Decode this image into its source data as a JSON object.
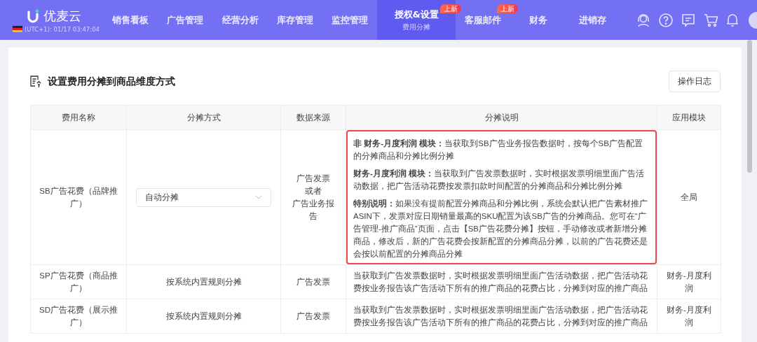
{
  "nav": {
    "logo": "优麦云",
    "timezone": "(UTC+1): 01/17 03:47:04",
    "items": [
      {
        "label": "销售看板",
        "selected": false
      },
      {
        "label": "广告管理",
        "selected": false
      },
      {
        "label": "经营分析",
        "selected": false
      },
      {
        "label": "库存管理",
        "selected": false
      },
      {
        "label": "监控管理",
        "selected": false
      },
      {
        "label": "授权&设置",
        "selected": true,
        "sub": "费用分摊",
        "badge": "上新"
      },
      {
        "label": "客服邮件",
        "selected": false,
        "badge": "上新"
      },
      {
        "label": "财务",
        "selected": false
      },
      {
        "label": "进销存",
        "selected": false
      }
    ]
  },
  "page": {
    "title": "设置费用分摊到商品维度方式",
    "log_button": "操作日志"
  },
  "table": {
    "columns": [
      "费用名称",
      "分摊方式",
      "数据来源",
      "分摊说明",
      "应用模块"
    ],
    "rows": [
      {
        "name": "SB广告花费（品牌推广）",
        "method": {
          "kind": "select",
          "value": "自动分摊"
        },
        "source": [
          "广告发票",
          "或者",
          "广告业务报告"
        ],
        "highlighted": true,
        "description": [
          "**非 财务-月度利润 模块：**当获取到SB广告业务报告数据时，按每个SB广告配置的分摊商品和分摊比例分摊",
          "**财务-月度利润 模块：**当获取到广告发票数据时，实时根据发票明细里面广告活动数据，把广告活动花费按发票扣款时间配置的分摊商品和分摊比例分摊",
          "**特别说明：**如果没有提前配置分摊商品和分摊比例，系统会默认把广告素材推广ASIN下，发票对应日期销量最高的SKU配置为该SB广告的分摊商品。您可在“广告管理-推广商品”页面，点击【SB广告花费分摊】按钮，手动修改或者新增分摊商品，修改后，新的广告花费会按新配置的分摊商品分摊，以前的广告花费还是会按以前配置的分摊商品分摊"
        ],
        "module": "全局"
      },
      {
        "name": "SP广告花费（商品推广）",
        "method": {
          "kind": "text",
          "value": "按系统内置规则分摊"
        },
        "source": [
          "广告发票"
        ],
        "highlighted": false,
        "description": [
          "当获取到广告发票数据时，实时根据发票明细里面广告活动数据，把广告活动花费按业务报告该广告活动下所有的推广商品的花费占比，分摊到对应的推广商品"
        ],
        "module": "财务-月度利润"
      },
      {
        "name": "SD广告花费（展示推广）",
        "method": {
          "kind": "text",
          "value": "按系统内置规则分摊"
        },
        "source": [
          "广告发票"
        ],
        "highlighted": false,
        "description": [
          "当获取到广告发票数据时，实时根据发票明细里面广告活动数据，把广告活动花费按业务报告该广告活动下所有的推广商品的花费占比，分摊到对应的推广商品"
        ],
        "module": "财务-月度利润"
      }
    ]
  }
}
